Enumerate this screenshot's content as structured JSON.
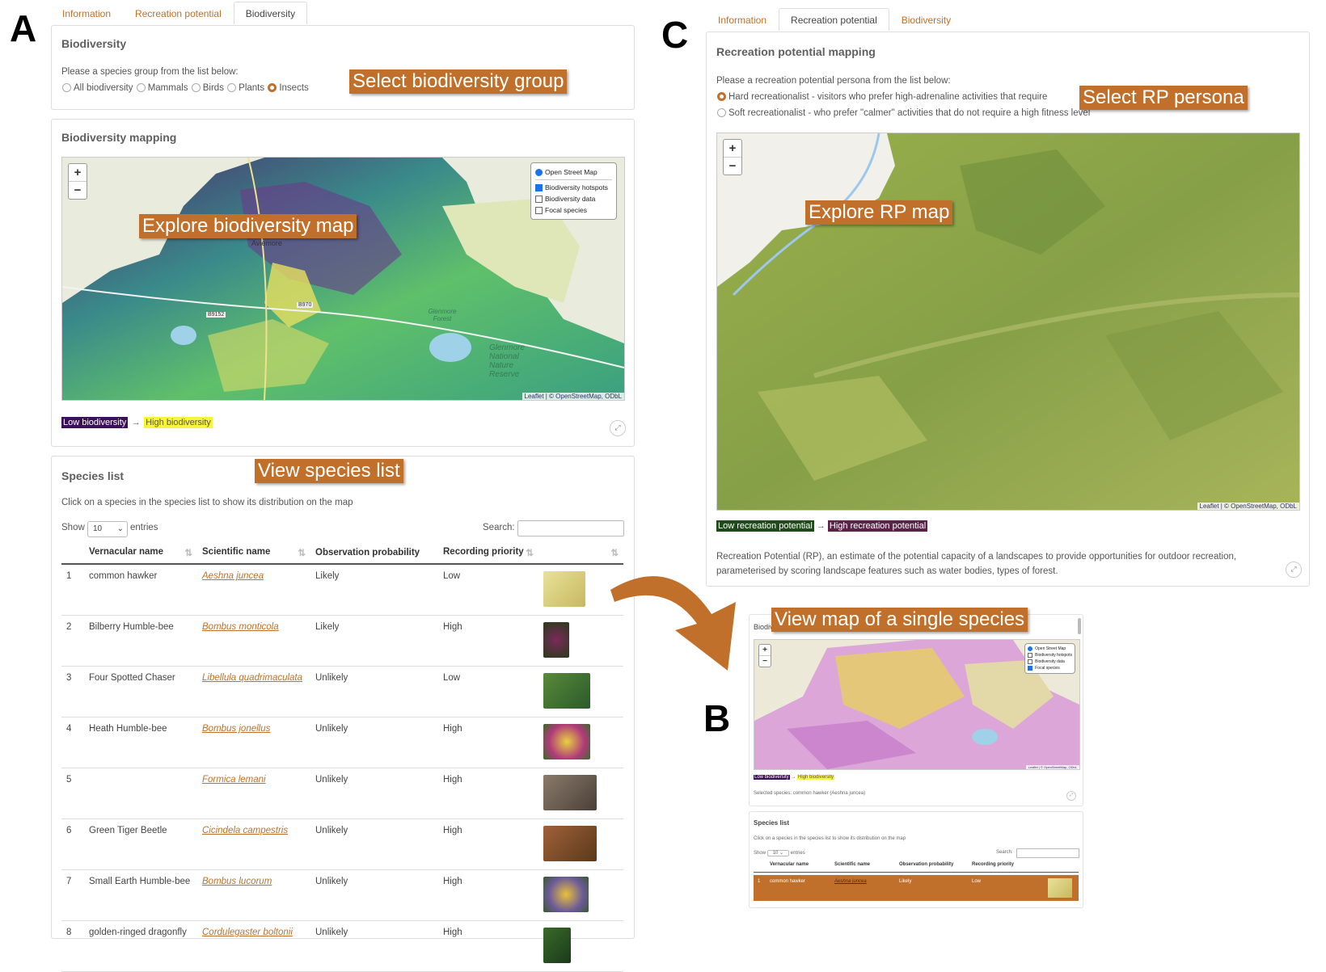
{
  "letters": {
    "a": "A",
    "b": "B",
    "c": "C"
  },
  "colors": {
    "accent": "#c0702a",
    "low_bio": "#3b0f5a",
    "high_bio": "#f8f43a",
    "low_rp": "#1f4a1a",
    "high_rp": "#5a2448"
  },
  "callouts": {
    "select_group": "Select biodiversity group",
    "explore_bio": "Explore biodiversity map",
    "view_species": "View species list",
    "select_rp": "Select RP persona",
    "explore_rp": "Explore RP map",
    "single_species": "View map of a single species"
  },
  "tabs": [
    "Information",
    "Recreation potential",
    "Biodiversity"
  ],
  "panel_a": {
    "biodiversity_card": {
      "title": "Biodiversity",
      "prompt": "Please a species group from the list below:",
      "options": [
        "All biodiversity",
        "Mammals",
        "Birds",
        "Plants",
        "Insects"
      ],
      "selected": "Insects"
    },
    "mapping_card": {
      "title": "Biodiversity mapping",
      "zoom_in": "+",
      "zoom_out": "−",
      "layers": {
        "base": "Open Street Map",
        "overlays": [
          "Biodiversity hotspots",
          "Biodiversity data",
          "Focal species"
        ],
        "checked": [
          "Biodiversity hotspots"
        ]
      },
      "attribution": "Leaflet | © OpenStreetMap, ODbL",
      "legend_low": "Low biodiversity",
      "legend_arrow": "→",
      "legend_high": "High biodiversity",
      "map_labels": [
        "Aviemore",
        "B9152",
        "B970",
        "Glenmore Forest",
        "Glenmore National Nature Reserve"
      ]
    },
    "species_card": {
      "title": "Species list",
      "hint": "Click on a species in the species list to show its distribution on the map",
      "show_label": "Show",
      "show_value": "10",
      "entries_label": "entries",
      "search_label": "Search:",
      "columns": [
        "",
        "Vernacular name",
        "Scientific name",
        "Observation probability",
        "Recording priority",
        ""
      ],
      "rows": [
        {
          "n": "1",
          "vernacular": "common hawker",
          "scientific": "Aeshna juncea",
          "prob": "Likely",
          "priority": "Low"
        },
        {
          "n": "2",
          "vernacular": "Bilberry Humble-bee",
          "scientific": "Bombus monticola",
          "prob": "Likely",
          "priority": "High"
        },
        {
          "n": "3",
          "vernacular": "Four Spotted Chaser",
          "scientific": "Libellula quadrimaculata",
          "prob": "Unlikely",
          "priority": "Low"
        },
        {
          "n": "4",
          "vernacular": "Heath Humble-bee",
          "scientific": "Bombus jonellus",
          "prob": "Unlikely",
          "priority": "High"
        },
        {
          "n": "5",
          "vernacular": "",
          "scientific": "Formica lemani",
          "prob": "Unlikely",
          "priority": "High"
        },
        {
          "n": "6",
          "vernacular": "Green Tiger Beetle",
          "scientific": "Cicindela campestris",
          "prob": "Unlikely",
          "priority": "High"
        },
        {
          "n": "7",
          "vernacular": "Small Earth Humble-bee",
          "scientific": "Bombus lucorum",
          "prob": "Unlikely",
          "priority": "High"
        },
        {
          "n": "8",
          "vernacular": "golden-ringed dragonfly",
          "scientific": "Cordulegaster boltonii",
          "prob": "Unlikely",
          "priority": "High"
        }
      ]
    }
  },
  "panel_c": {
    "title": "Recreation potential mapping",
    "prompt": "Please a recreation potential persona from the list below:",
    "options": [
      "Hard recreationalist - visitors who prefer high-adrenaline activities that require",
      "Soft recreationalist - who prefer \"calmer\" activities that do not require a high fitness level"
    ],
    "attribution": "Leaflet | © OpenStreetMap, ODbL",
    "legend_low": "Low recreation potential",
    "legend_arrow": "→",
    "legend_high": "High recreation potential",
    "description": "Recreation Potential (RP), an estimate of the potential capacity of a landscapes to provide opportunities for outdoor recreation, parameterised by scoring landscape features such as water bodies, types of forest."
  },
  "panel_b": {
    "title": "Biodiv",
    "layers": [
      "Open Street Map",
      "Biodiversity hotspots",
      "Biodiversity data",
      "Focal species"
    ],
    "legend_low": "Low biodiversity",
    "legend_arrow": "→",
    "legend_high": "High biodiversity",
    "selected_species": "Selected species: common hawker (Aeshna juncea)",
    "list_title": "Species list",
    "hint": "Click on a species in the species list to show its distribution on the map",
    "show_label": "Show",
    "show_value": "10",
    "entries_label": "entries",
    "search_label": "Search:",
    "columns": [
      "Vernacular name",
      "Scientific name",
      "Observation probability",
      "Recording priority"
    ],
    "row": {
      "n": "1",
      "vernacular": "common hawker",
      "scientific": "Aeshna juncea",
      "prob": "Likely",
      "priority": "Low"
    },
    "attribution": "Leaflet | © OpenStreetMap, ODbL"
  }
}
